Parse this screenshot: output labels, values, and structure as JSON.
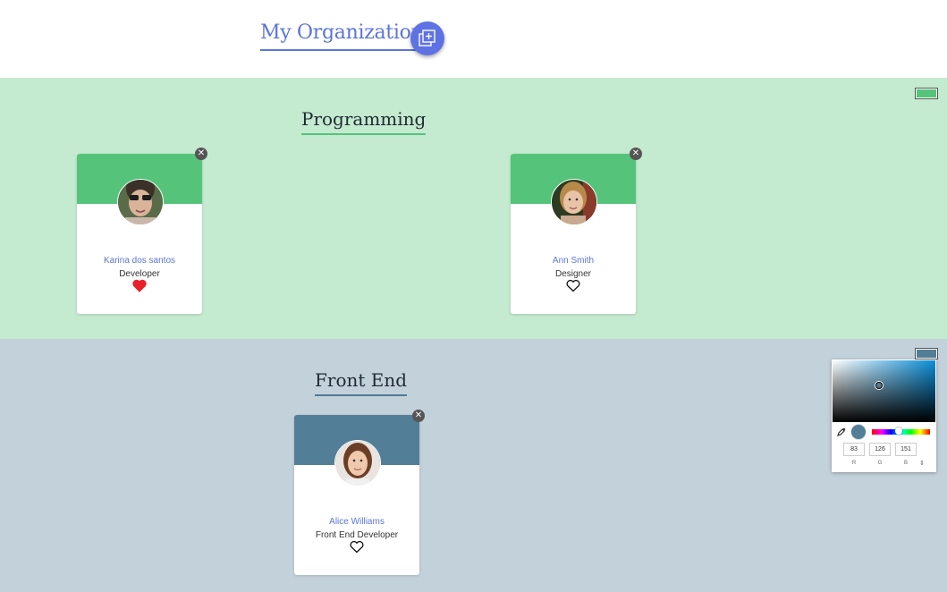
{
  "header": {
    "title": "My Organization",
    "add_icon": "add-layer-icon"
  },
  "sections": [
    {
      "title": "Programming",
      "color": "#55c47a",
      "background": "#c4ead0",
      "cards": [
        {
          "name": "Karina dos santos",
          "role": "Developer",
          "liked": true,
          "photo": "photo-of-karina"
        },
        {
          "name": "Ann Smith",
          "role": "Designer",
          "liked": false,
          "photo": "photo-of-ann"
        }
      ]
    },
    {
      "title": "Front End",
      "color": "#537e97",
      "background": "#c3d1da",
      "cards": [
        {
          "name": "Alice Williams",
          "role": "Front End Developer",
          "liked": false,
          "photo": "photo-of-alice"
        }
      ]
    }
  ],
  "color_picker": {
    "r": "83",
    "g": "126",
    "b": "151",
    "labels": {
      "r": "R",
      "g": "G",
      "b": "B"
    },
    "current_color": "#537e97",
    "eyedropper_icon": "eyedropper-icon",
    "toggle_icon": "up-down-arrows-icon"
  },
  "close_icon": "close-icon",
  "heart_icon": "heart-icon",
  "heart_color": "#e8202a"
}
